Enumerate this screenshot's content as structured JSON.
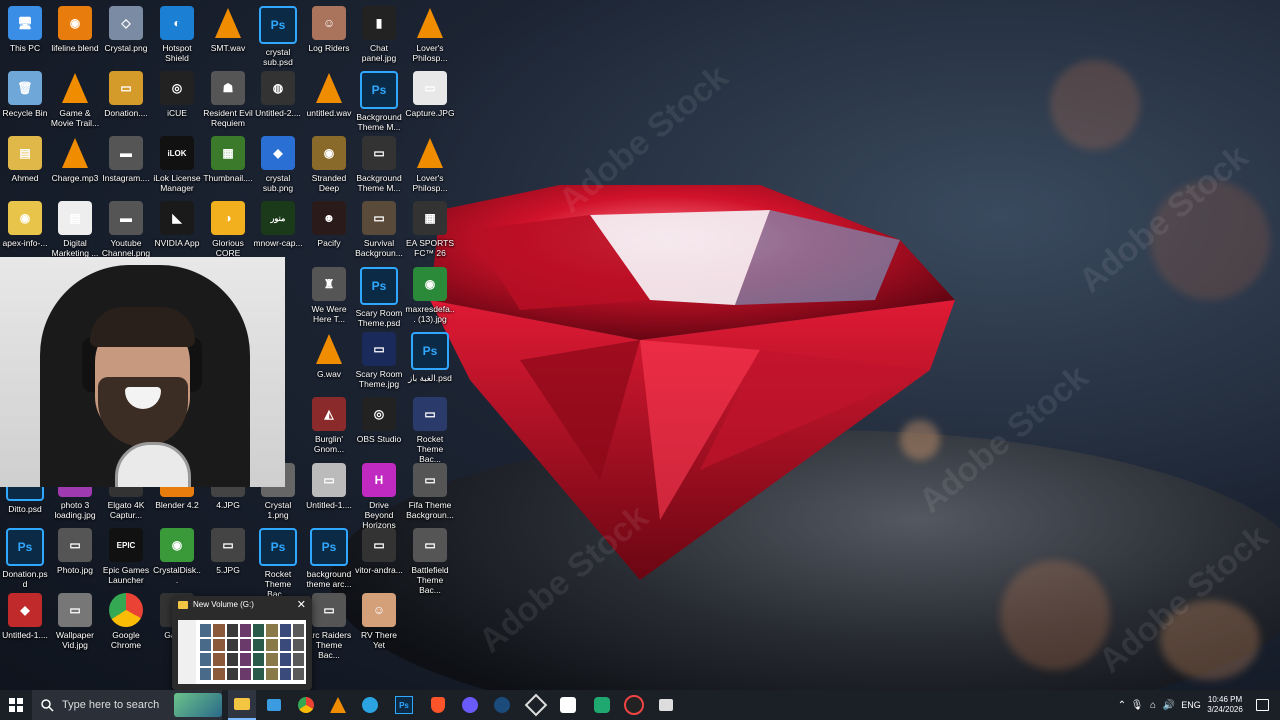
{
  "desktop": {
    "icons": [
      {
        "label": "This PC",
        "color": "#3a8ee6",
        "glyph": "🖥"
      },
      {
        "label": "lifeline.blend",
        "color": "#e87d0d",
        "glyph": "◉"
      },
      {
        "label": "Crystal.png",
        "color": "#7a8ba3",
        "glyph": "◇"
      },
      {
        "label": "Hotspot Shield",
        "color": "#1b7fd4",
        "glyph": "◐"
      },
      {
        "label": "SMT.wav",
        "color": "vlc",
        "glyph": ""
      },
      {
        "label": "crystal sub.psd",
        "color": "ps",
        "glyph": "Ps"
      },
      {
        "label": "Log Riders",
        "color": "#a9745b",
        "glyph": "☺"
      },
      {
        "label": "Chat panel.jpg",
        "color": "#222",
        "glyph": "▮"
      },
      {
        "label": "Lover's Philosp...",
        "color": "vlc",
        "glyph": ""
      },
      {
        "label": "Recycle Bin",
        "color": "#6fa7d8",
        "glyph": "🗑"
      },
      {
        "label": "Game & Movie Trail...",
        "color": "vlc",
        "glyph": ""
      },
      {
        "label": "Donation....",
        "color": "#d49a2a",
        "glyph": "▭"
      },
      {
        "label": "iCUE",
        "color": "#222",
        "glyph": "◎"
      },
      {
        "label": "Resident Evil Requiem",
        "color": "#555",
        "glyph": "☗"
      },
      {
        "label": "Untitled-2....",
        "color": "#333",
        "glyph": "◍"
      },
      {
        "label": "untitled.wav",
        "color": "vlc",
        "glyph": ""
      },
      {
        "label": "Background Theme M...",
        "color": "ps",
        "glyph": "Ps"
      },
      {
        "label": "Capture.JPG",
        "color": "#e8e8e8",
        "glyph": "▭"
      },
      {
        "label": "Ahmed",
        "color": "#e0b84a",
        "glyph": "▤"
      },
      {
        "label": "Charge.mp3",
        "color": "vlc",
        "glyph": ""
      },
      {
        "label": "Instagram....",
        "color": "#555",
        "glyph": "▬"
      },
      {
        "label": "iLok License Manager",
        "color": "#111",
        "glyph": "iLOK"
      },
      {
        "label": "Thumbnail....",
        "color": "#3a7a2a",
        "glyph": "▦"
      },
      {
        "label": "crystal sub.png",
        "color": "#2a6fd4",
        "glyph": "◆"
      },
      {
        "label": "Stranded Deep",
        "color": "#8a6a2a",
        "glyph": "◉"
      },
      {
        "label": "Background Theme M...",
        "color": "#333",
        "glyph": "▭"
      },
      {
        "label": "Lover's Philosp...",
        "color": "vlc",
        "glyph": ""
      },
      {
        "label": "apex-info-...",
        "color": "#e8c54a",
        "glyph": "◉"
      },
      {
        "label": "Digital Marketing ...",
        "color": "#eee",
        "glyph": "▤"
      },
      {
        "label": "Youtube Channel.png",
        "color": "#555",
        "glyph": "▬"
      },
      {
        "label": "NVIDIA App",
        "color": "#1a1a1a",
        "glyph": "◣"
      },
      {
        "label": "Glorious CORE",
        "color": "#f2b01e",
        "glyph": "◑"
      },
      {
        "label": "mnowr-cap...",
        "color": "#1a3a1a",
        "glyph": "منور"
      },
      {
        "label": "Pacify",
        "color": "#2a1a1a",
        "glyph": "☻"
      },
      {
        "label": "Survival Backgroun...",
        "color": "#5a4a3a",
        "glyph": "▭"
      },
      {
        "label": "EA SPORTS FC™ 26",
        "color": "#333",
        "glyph": "▦"
      }
    ],
    "col2": [
      {
        "label": "We Were Here T...",
        "color": "#555",
        "glyph": "♜"
      },
      {
        "label": "Scary Room Theme.psd",
        "color": "ps",
        "glyph": "Ps"
      },
      {
        "label": "maxresdefa... (13).jpg",
        "color": "#2a8a3a",
        "glyph": "◉"
      },
      {
        "label": "G.wav",
        "color": "vlc",
        "glyph": ""
      },
      {
        "label": "Scary Room Theme.jpg",
        "color": "#1a2a5a",
        "glyph": "▭"
      },
      {
        "label": "الغبة باز.psd",
        "color": "ps",
        "glyph": "Ps"
      },
      {
        "label": "Burglin' Gnom...",
        "color": "#8a2a2a",
        "glyph": "◭"
      },
      {
        "label": "OBS Studio",
        "color": "#222",
        "glyph": "◎"
      },
      {
        "label": "Rocket Theme Bac...",
        "color": "#2a3a6a",
        "glyph": "▭"
      }
    ],
    "row8": [
      {
        "label": "Ditto.psd",
        "color": "ps",
        "glyph": "Ps"
      },
      {
        "label": "photo 3 loading.jpg",
        "color": "#a03ab0",
        "glyph": "▭"
      },
      {
        "label": "Elgato 4K Captur...",
        "color": "#333",
        "glyph": "◻"
      },
      {
        "label": "Blender 4.2",
        "color": "#e87d0d",
        "glyph": "◉"
      },
      {
        "label": "4.JPG",
        "color": "#444",
        "glyph": "▭"
      },
      {
        "label": "Crystal 1.png",
        "color": "#666",
        "glyph": "◇"
      },
      {
        "label": "Untitled-1....",
        "color": "#bbb",
        "glyph": "▭"
      },
      {
        "label": "Drive Beyond Horizons",
        "color": "#c02ac0",
        "glyph": "H"
      },
      {
        "label": "Fifa Theme Backgroun...",
        "color": "#555",
        "glyph": "▭"
      }
    ],
    "row9": [
      {
        "label": "Donation.psd",
        "color": "ps",
        "glyph": "Ps"
      },
      {
        "label": "Photo.jpg",
        "color": "#555",
        "glyph": "▭"
      },
      {
        "label": "Epic Games Launcher",
        "color": "#111",
        "glyph": "EPIC"
      },
      {
        "label": "CrystalDisk...",
        "color": "#3a9a3a",
        "glyph": "◉"
      },
      {
        "label": "5.JPG",
        "color": "#444",
        "glyph": "▭"
      },
      {
        "label": "Rocket Theme Bac...",
        "color": "ps",
        "glyph": "Ps"
      },
      {
        "label": "background theme arc...",
        "color": "ps",
        "glyph": "Ps"
      },
      {
        "label": "vitor-andra...",
        "color": "#333",
        "glyph": "▭"
      },
      {
        "label": "Battlefield Theme Bac...",
        "color": "#555",
        "glyph": "▭"
      }
    ],
    "row10": [
      {
        "label": "Untitled-1....",
        "color": "#c02a2a",
        "glyph": "◆"
      },
      {
        "label": "Wallpaper Vid.jpg",
        "color": "#777",
        "glyph": "▭"
      },
      {
        "label": "Google Chrome",
        "color": "chrome",
        "glyph": ""
      },
      {
        "label": "Gam...",
        "color": "#333",
        "glyph": "▭"
      },
      {
        "label": "Arc Raiders Theme Bac...",
        "color": "#555",
        "glyph": "▭"
      },
      {
        "label": "RV There Yet",
        "color": "#d4a07a",
        "glyph": "☺"
      }
    ]
  },
  "preview": {
    "title": "New Volume (G:)",
    "close": "✕"
  },
  "taskbar": {
    "search_placeholder": "Type here to search",
    "lang": "ENG",
    "time": "10:46 PM",
    "date": "3/24/2026"
  }
}
